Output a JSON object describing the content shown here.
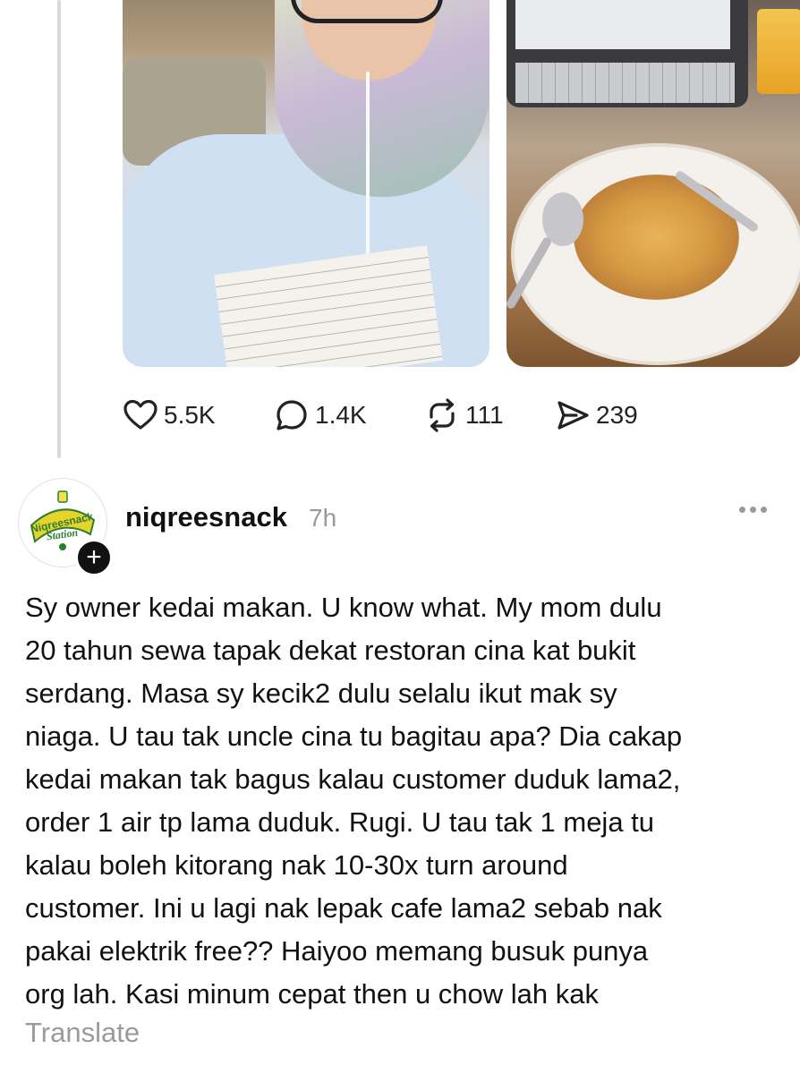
{
  "previous_post": {
    "images": [
      {
        "name": "selfie-photo"
      },
      {
        "name": "food-photo"
      }
    ],
    "actions": {
      "like": {
        "icon": "heart-icon",
        "count": "5.5K"
      },
      "reply": {
        "icon": "comment-icon",
        "count": "1.4K"
      },
      "repost": {
        "icon": "repost-icon",
        "count": "111"
      },
      "share": {
        "icon": "send-icon",
        "count": "239"
      }
    }
  },
  "post": {
    "avatar": {
      "logo_text_line1": "Niqreesnack",
      "logo_text_line2": "Station",
      "badge": "+"
    },
    "username": "niqreesnack",
    "time": "7h",
    "more_icon": "more-horizontal-icon",
    "text_lines": [
      "Sy owner kedai makan. U know what. My mom dulu",
      "20 tahun sewa tapak dekat restoran cina kat bukit",
      "serdang. Masa sy kecik2 dulu selalu ikut mak sy",
      "niaga. U tau tak uncle cina tu bagitau apa? Dia cakap",
      "kedai makan tak bagus kalau customer duduk lama2,",
      "order 1 air tp lama duduk. Rugi. U tau tak 1 meja tu",
      "kalau boleh kitorang nak 10-30x turn around",
      "customer. Ini u lagi nak lepak cafe lama2 sebab nak",
      "pakai elektrik free?? Haiyoo memang busuk punya",
      "org lah. Kasi minum cepat then u chow lah kak"
    ],
    "translate_label": "Translate"
  },
  "colors": {
    "text": "#111111",
    "muted": "#9a9a9a",
    "logo_yellow": "#e7d42a",
    "logo_green": "#2e7d32"
  }
}
